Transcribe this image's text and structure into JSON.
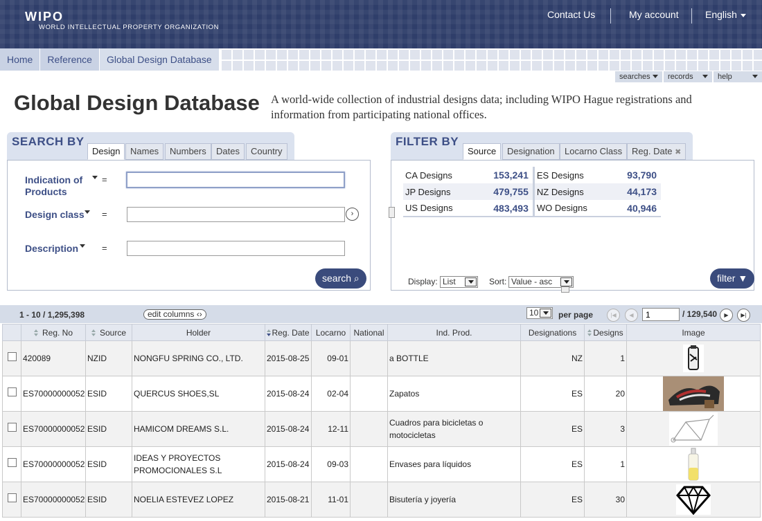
{
  "header": {
    "logo": "WIPO",
    "org": "WORLD INTELLECTUAL PROPERTY ORGANIZATION",
    "contact": "Contact Us",
    "account": "My account",
    "language": "English"
  },
  "breadcrumb": [
    "Home",
    "Reference",
    "Global Design Database"
  ],
  "menus": [
    "searches",
    "records",
    "help"
  ],
  "page": {
    "title": "Global Design Database",
    "description": "A world-wide collection of industrial designs data; including WIPO Hague registrations and information from participating national offices."
  },
  "search": {
    "heading": "SEARCH BY",
    "tabs": [
      "Design",
      "Names",
      "Numbers",
      "Dates",
      "Country"
    ],
    "fields": [
      {
        "label": "Indication of Products",
        "op": "=",
        "value": ""
      },
      {
        "label": "Design class",
        "op": "=",
        "value": ""
      },
      {
        "label": "Description",
        "op": "=",
        "value": ""
      }
    ],
    "button": "search"
  },
  "filter": {
    "heading": "FILTER BY",
    "tabs": [
      "Source",
      "Designation",
      "Locarno Class",
      "Reg. Date"
    ],
    "close_glyph": "✖",
    "sources": [
      {
        "name": "CA Designs",
        "count": "153,241"
      },
      {
        "name": "ES Designs",
        "count": "93,790"
      },
      {
        "name": "JP Designs",
        "count": "479,755"
      },
      {
        "name": "NZ Designs",
        "count": "44,173"
      },
      {
        "name": "US Designs",
        "count": "483,493"
      },
      {
        "name": "WO Designs",
        "count": "40,946"
      }
    ],
    "display_label": "Display:",
    "display_value": "List",
    "sort_label": "Sort:",
    "sort_value": "Value - asc",
    "button": "filter"
  },
  "results": {
    "range": "1 - 10 / 1,295,398",
    "edit_columns": "edit columns",
    "per_page_value": "10",
    "per_page_label": "per page",
    "page": "1",
    "pages": "/ 129,540",
    "columns": [
      "Reg. No",
      "Source",
      "Holder",
      "Reg. Date",
      "Locarno",
      "National",
      "Ind. Prod.",
      "Designations",
      "Designs",
      "Image"
    ],
    "rows": [
      {
        "reg_no": "420089",
        "source": "NZID",
        "holder": "NONGFU SPRING CO., LTD.",
        "date": "2015-08-25",
        "locarno": "09-01",
        "national": "",
        "ind_prod": "a BOTTLE",
        "designations": "NZ",
        "designs": "1",
        "image": "bottle-thumbnail"
      },
      {
        "reg_no": "ES70000000052",
        "source": "ESID",
        "holder": "QUERCUS SHOES,SL",
        "date": "2015-08-24",
        "locarno": "02-04",
        "national": "",
        "ind_prod": "Zapatos",
        "designations": "ES",
        "designs": "20",
        "image": "shoe-thumbnail"
      },
      {
        "reg_no": "ES70000000052",
        "source": "ESID",
        "holder": "HAMICOM DREAMS S.L.",
        "date": "2015-08-24",
        "locarno": "12-11",
        "national": "",
        "ind_prod": "Cuadros para bicicletas o motocicletas",
        "designations": "ES",
        "designs": "3",
        "image": "bicycle-frame-thumbnail"
      },
      {
        "reg_no": "ES70000000052",
        "source": "ESID",
        "holder": "IDEAS Y PROYECTOS PROMOCIONALES S.L",
        "date": "2015-08-24",
        "locarno": "09-03",
        "national": "",
        "ind_prod": "Envases para líquidos",
        "designations": "ES",
        "designs": "1",
        "image": "container-thumbnail"
      },
      {
        "reg_no": "ES70000000052",
        "source": "ESID",
        "holder": "NOELIA ESTEVEZ LOPEZ",
        "date": "2015-08-21",
        "locarno": "11-01",
        "national": "",
        "ind_prod": "Bisutería y joyería",
        "designations": "ES",
        "designs": "30",
        "image": "diamond-thumbnail"
      }
    ]
  }
}
